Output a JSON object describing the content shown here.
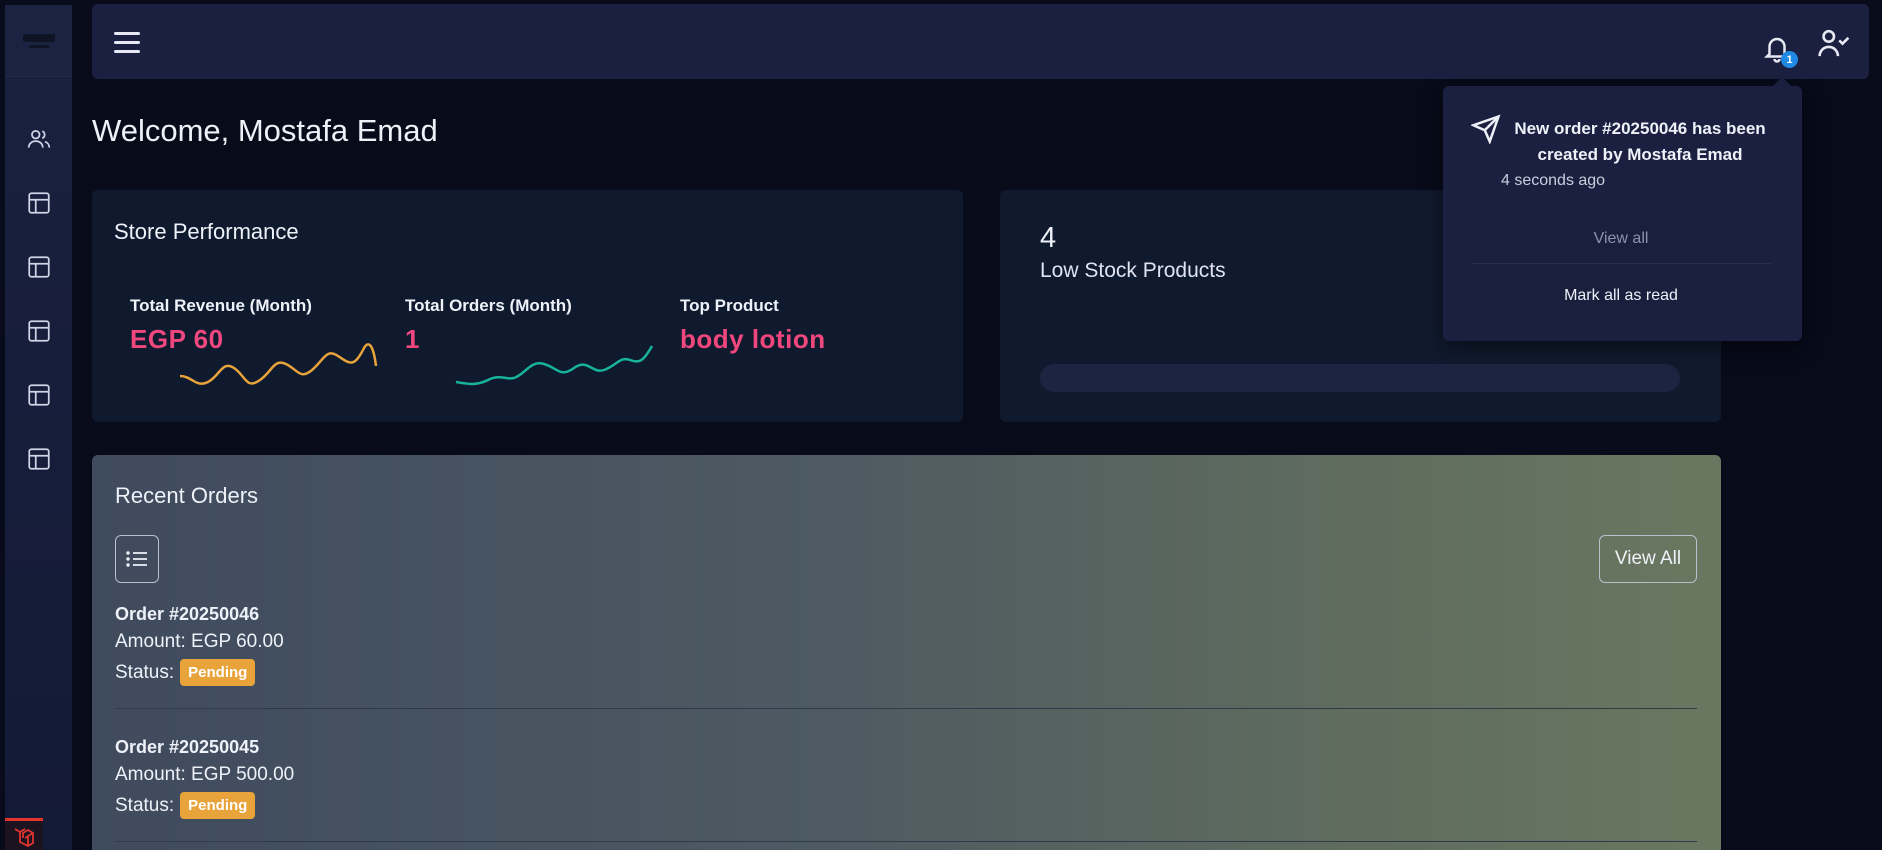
{
  "sidebar": {
    "items": [
      {
        "icon": "users-icon"
      },
      {
        "icon": "layout-icon"
      },
      {
        "icon": "layout-icon"
      },
      {
        "icon": "layout-icon"
      },
      {
        "icon": "layout-icon"
      },
      {
        "icon": "layout-icon"
      }
    ]
  },
  "header": {
    "notification_count": "1"
  },
  "welcome": "Welcome, Mostafa Emad",
  "store_performance": {
    "title": "Store Performance",
    "revenue_label": "Total Revenue (Month)",
    "revenue_value": "EGP 60",
    "orders_label": "Total Orders (Month)",
    "orders_value": "1",
    "top_product_label": "Top Product",
    "top_product_value": "body lotion",
    "colors": {
      "revenue_line": "#e8a33a",
      "orders_line": "#18b39b",
      "value_text": "#f0477e"
    }
  },
  "low_stock": {
    "count": "4",
    "label": "Low Stock Products"
  },
  "recent_orders": {
    "title": "Recent Orders",
    "view_all_label": "View All",
    "orders": [
      {
        "id": "Order #20250046",
        "amount": "Amount: EGP 60.00",
        "status_label": "Status:",
        "status": "Pending"
      },
      {
        "id": "Order #20250045",
        "amount": "Amount: EGP 500.00",
        "status_label": "Status:",
        "status": "Pending"
      }
    ]
  },
  "notifications": {
    "items": [
      {
        "message": "New order #20250046 has been created by Mostafa Emad",
        "time": "4 seconds ago"
      }
    ],
    "view_all_label": "View all",
    "mark_all_label": "Mark all as read"
  }
}
